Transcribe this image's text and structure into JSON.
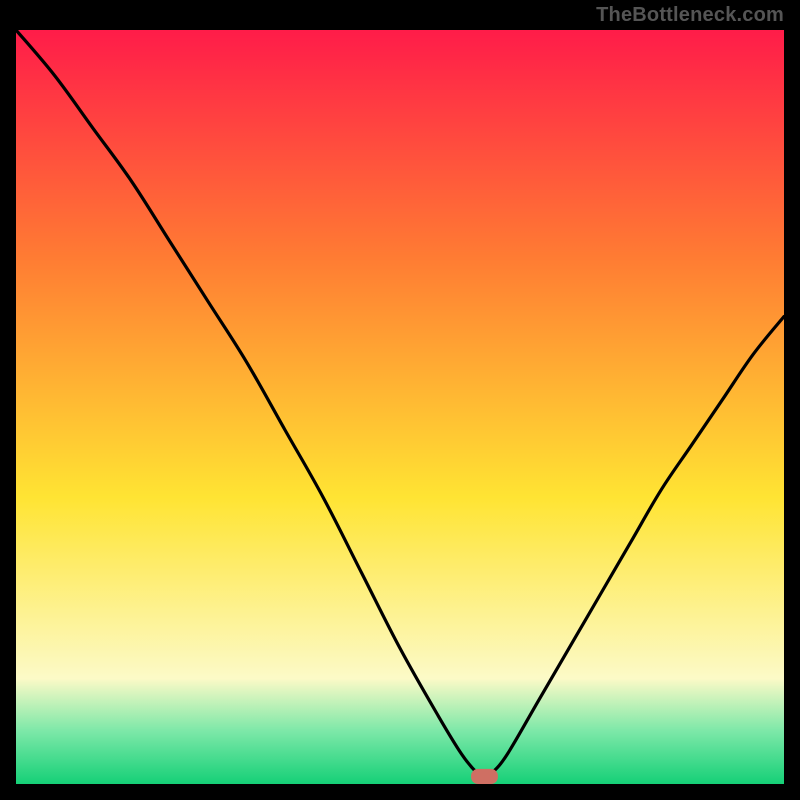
{
  "attribution": "TheBottleneck.com",
  "colors": {
    "top": "#ff1c49",
    "mid_upper": "#ff7b33",
    "mid": "#ffe433",
    "mid_lower": "#fcfac7",
    "low_green_light": "#7ce8a8",
    "bottom": "#15d077",
    "curve": "#000000",
    "marker": "#cf6f63",
    "frame": "#000000"
  },
  "chart_data": {
    "type": "line",
    "title": "",
    "xlabel": "",
    "ylabel": "",
    "xlim": [
      0,
      100
    ],
    "ylim": [
      0,
      100
    ],
    "optimum_x": 61,
    "series": [
      {
        "name": "bottleneck-curve",
        "x": [
          0,
          5,
          10,
          15,
          20,
          25,
          30,
          35,
          40,
          45,
          50,
          55,
          58,
          60,
          61,
          62,
          64,
          68,
          72,
          76,
          80,
          84,
          88,
          92,
          96,
          100
        ],
        "values": [
          100,
          94,
          87,
          80,
          72,
          64,
          56,
          47,
          38,
          28,
          18,
          9,
          4,
          1.5,
          1,
          1.5,
          4,
          11,
          18,
          25,
          32,
          39,
          45,
          51,
          57,
          62
        ]
      }
    ],
    "marker": {
      "x": 61,
      "y": 1,
      "width_x": 3.5,
      "height_y": 2
    },
    "gradient_stops": [
      {
        "offset": 0.0,
        "color": "#ff1c49"
      },
      {
        "offset": 0.3,
        "color": "#ff7b33"
      },
      {
        "offset": 0.62,
        "color": "#ffe433"
      },
      {
        "offset": 0.86,
        "color": "#fcfac7"
      },
      {
        "offset": 0.93,
        "color": "#7ce8a8"
      },
      {
        "offset": 1.0,
        "color": "#15d077"
      }
    ]
  }
}
